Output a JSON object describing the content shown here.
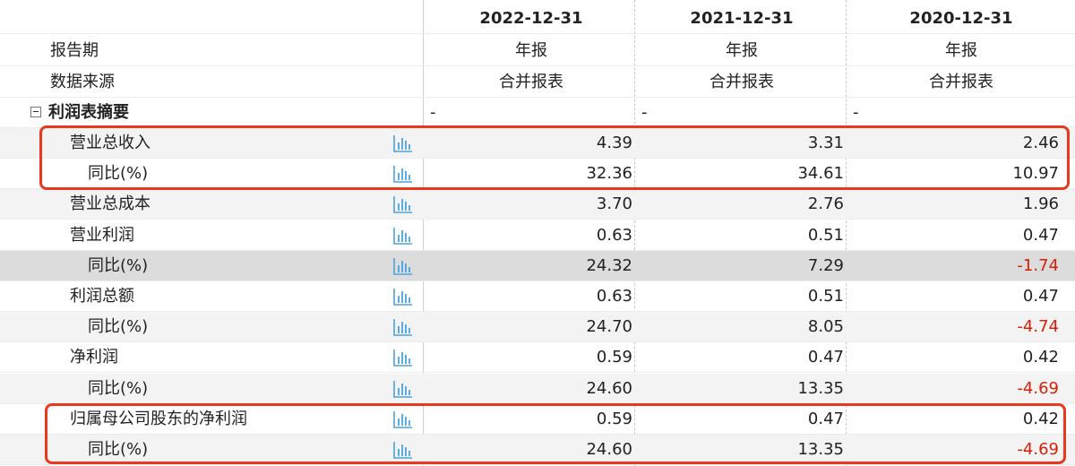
{
  "header": {
    "columns": [
      "2022-12-31",
      "2021-12-31",
      "2020-12-31"
    ]
  },
  "info_rows": [
    {
      "label": "报告期",
      "values": [
        "年报",
        "年报",
        "年报"
      ]
    },
    {
      "label": "数据来源",
      "values": [
        "合并报表",
        "合并报表",
        "合并报表"
      ]
    }
  ],
  "section": {
    "label": "利润表摘要",
    "values": [
      "-",
      "-",
      "-"
    ]
  },
  "rows": [
    {
      "label": "营业总收入",
      "indent": 1,
      "values": [
        "4.39",
        "3.31",
        "2.46"
      ],
      "negative": [
        false,
        false,
        false
      ]
    },
    {
      "label": "同比(%)",
      "indent": 2,
      "values": [
        "32.36",
        "34.61",
        "10.97"
      ],
      "negative": [
        false,
        false,
        false
      ]
    },
    {
      "label": "营业总成本",
      "indent": 1,
      "values": [
        "3.70",
        "2.76",
        "1.96"
      ],
      "negative": [
        false,
        false,
        false
      ]
    },
    {
      "label": "营业利润",
      "indent": 1,
      "values": [
        "0.63",
        "0.51",
        "0.47"
      ],
      "negative": [
        false,
        false,
        false
      ]
    },
    {
      "label": "同比(%)",
      "indent": 2,
      "values": [
        "24.32",
        "7.29",
        "-1.74"
      ],
      "negative": [
        false,
        false,
        true
      ]
    },
    {
      "label": "利润总额",
      "indent": 1,
      "values": [
        "0.63",
        "0.51",
        "0.47"
      ],
      "negative": [
        false,
        false,
        false
      ]
    },
    {
      "label": "同比(%)",
      "indent": 2,
      "values": [
        "24.70",
        "8.05",
        "-4.74"
      ],
      "negative": [
        false,
        false,
        true
      ]
    },
    {
      "label": "净利润",
      "indent": 1,
      "values": [
        "0.59",
        "0.47",
        "0.42"
      ],
      "negative": [
        false,
        false,
        false
      ]
    },
    {
      "label": "同比(%)",
      "indent": 2,
      "values": [
        "24.60",
        "13.35",
        "-4.69"
      ],
      "negative": [
        false,
        false,
        true
      ]
    },
    {
      "label": "归属母公司股东的净利润",
      "indent": 1,
      "values": [
        "0.59",
        "0.47",
        "0.42"
      ],
      "negative": [
        false,
        false,
        false
      ]
    },
    {
      "label": "同比(%)",
      "indent": 2,
      "values": [
        "24.60",
        "13.35",
        "-4.69"
      ],
      "negative": [
        false,
        false,
        true
      ]
    }
  ],
  "icons": {
    "row_chart": "bar-chart-icon",
    "section_toggle": "collapse-minus-icon"
  },
  "colors": {
    "negative": "#d81e06",
    "highlight_box": "#e8391d",
    "icon": "#4aa3df"
  }
}
